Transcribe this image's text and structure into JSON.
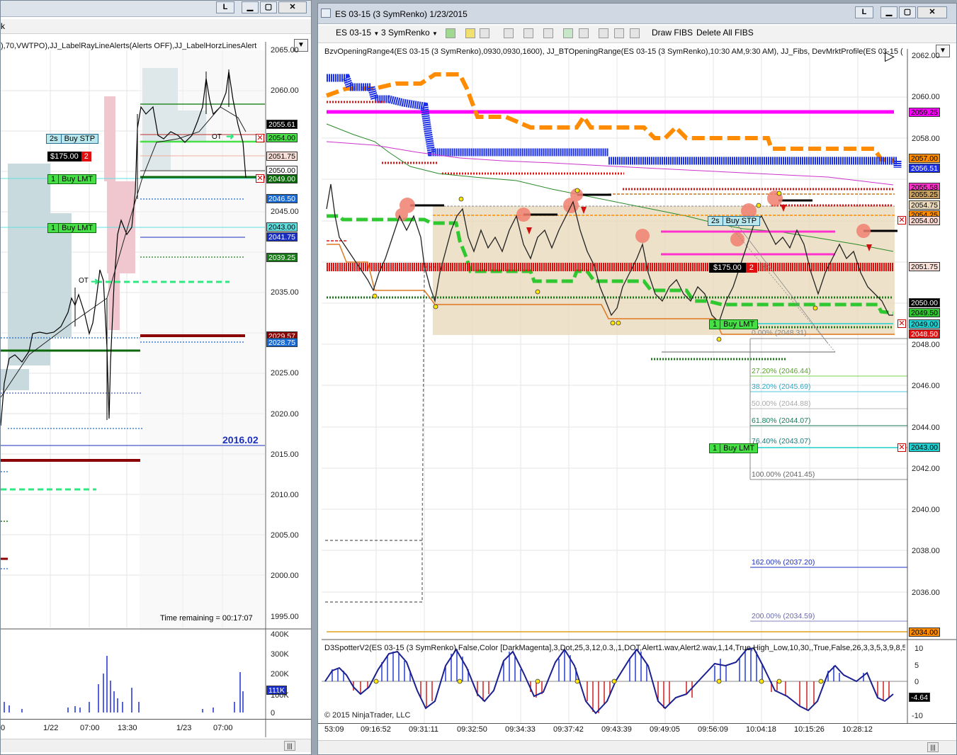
{
  "left_window": {
    "title_fragment": "k",
    "btn_l": "L",
    "indicator_line": "),70,VWTPO),JJ_LabelRayLineAlerts(Alerts OFF),JJ_LabelHorzLinesAlert",
    "price_axis": [
      "2065.00",
      "2060.00",
      "2055.00",
      "2050.00",
      "2045.00",
      "2040.00",
      "2035.00",
      "2030.00",
      "2025.00",
      "2020.00",
      "2015.00",
      "2010.00",
      "2005.00",
      "2000.00",
      "1995.00"
    ],
    "tags": {
      "last": "2055.61",
      "p2054": "2054.00",
      "p2051": "2051.75",
      "p2050": "2050.00",
      "p2049": "2049.00",
      "p2046": "2046.50",
      "p2043": "2043.00",
      "p2041": "2041.75",
      "p2039": "2039.25",
      "p2029": "2029.57",
      "p2028": "2028.75"
    },
    "orders": {
      "buy_stp_q": "2s",
      "buy_stp_t": "Buy STP",
      "pnl": "$175.00",
      "pnl_q": "2",
      "buy_lmt1_q": "1",
      "buy_lmt1_t": "Buy LMT",
      "buy_lmt2_q": "1",
      "buy_lmt2_t": "Buy LMT"
    },
    "ot1": "OT",
    "ot2": "OT",
    "big_label": "2016.02",
    "time_remaining": "Time remaining = 00:17:07",
    "volume_axis": [
      "400K",
      "300K",
      "200K",
      "111K",
      "100K",
      "0"
    ],
    "time_axis": [
      "0",
      "1/22",
      "07:00",
      "13:30",
      "1/23",
      "07:00"
    ]
  },
  "right_window": {
    "title": "ES 03-15 (3 SymRenko)  1/23/2015",
    "btn_l": "L",
    "toolbar": {
      "instrument": "ES 03-15",
      "period": "3 SymRenko",
      "draw_fibs": "Draw FIBS",
      "delete_fibs": "Delete All FIBS"
    },
    "indicator_line": "BzvOpeningRange4(ES 03-15 (3 SymRenko),0930,0930,1600), JJ_BTOpeningRange(ES 03-15 (3 SymRenko),10:30 AM,9:30 AM), JJ_Fibs, DevMrktProfile(ES 03-15 (",
    "price_axis": [
      "2062.00",
      "2060.00",
      "2058.00",
      "2056.00",
      "2054.00",
      "2052.00",
      "2050.00",
      "2048.00",
      "2046.00",
      "2044.00",
      "2042.00",
      "2040.00",
      "2038.00",
      "2036.00"
    ],
    "tags": {
      "p2059": "2059.25",
      "p2057": "2057.00",
      "p2056": "2056.51",
      "p2055_58": "2055.58",
      "p2055_25": "2055.25",
      "p2054_75": "2054.75",
      "p2054_25": "2054.25",
      "p2054": "2054.00",
      "p2051": "2051.75",
      "p2050": "2050.00",
      "p2049_50": "2049.50",
      "p2049": "2049.00",
      "p2048": "2048.50",
      "p2043": "2043.00",
      "p2034": "2034.00"
    },
    "orders": {
      "buy_stp_q": "2s",
      "buy_stp_t": "Buy STP",
      "pnl": "$175.00",
      "pnl_q": "2",
      "buy_lmt1_q": "1",
      "buy_lmt1_t": "Buy LMT",
      "buy_lmt2_q": "1",
      "buy_lmt2_t": "Buy LMT"
    },
    "fibs": {
      "f0": "0.00% (2048.31)",
      "f27": "27.20% (2046.44)",
      "f38": "38.20% (2045.69)",
      "f50": "50.00% (2044.88)",
      "f61": "61.80% (2044.07)",
      "f76": "76.40% (2043.07)",
      "f100": "100.00% (2041.45)",
      "f162": "162.00% (2037.20)",
      "f200": "200.00% (2034.59)"
    },
    "osc_line": "D3SpotterV2(ES 03-15 (3 SymRenko),False,Color [DarkMagenta],3,Dot,25,3,12,0.3,,1,DOT,Alert1.wav,Alert2.wav,1,14,True,High_Low,10,30,,True,False,26,3,3,5,3,9,8,5",
    "osc_axis": [
      "10",
      "5",
      "0",
      "-5",
      "-10"
    ],
    "osc_value": "-4.64",
    "copyright": "© 2015 NinjaTrader, LLC",
    "time_axis": [
      "53:09",
      "09:16:52",
      "09:31:11",
      "09:32:50",
      "09:34:33",
      "09:37:42",
      "09:43:39",
      "09:49:05",
      "09:56:09",
      "10:04:18",
      "10:15:26",
      "10:28:12"
    ]
  },
  "colors": {
    "buy_green": "#46e046",
    "orange": "#ff8c00",
    "magenta": "#ff00ff",
    "blue": "#1a2fe6",
    "red": "#e01010",
    "range_fill": "#ead9bb"
  }
}
